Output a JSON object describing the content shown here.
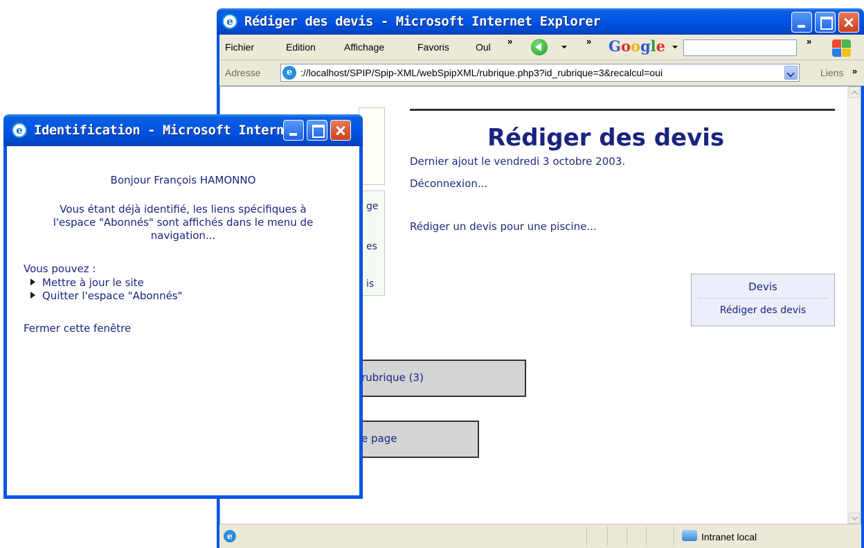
{
  "main_window": {
    "title": "Rédiger des devis - Microsoft Internet Explorer",
    "menu": [
      "Fichier",
      "Edition",
      "Affichage",
      "Favoris",
      "Oul"
    ],
    "google": "Google",
    "address_label": "Adresse",
    "address_url": "://localhost/SPIP/Spip-XML/webSpipXML/rubrique.php3?id_rubrique=3&recalcul=oui",
    "links_label": "Liens",
    "status_zone": "Intranet local"
  },
  "page": {
    "title": "Rédiger des devis",
    "date": "Dernier ajout le vendredi 3 octobre 2003.",
    "logout": "Déconnexion...",
    "link": "Rédiger un devis pour une piscine...",
    "side_fragments": [
      "ge",
      "es",
      "is"
    ],
    "nav_box": {
      "heading": "Devis",
      "link": "Rédiger des devis"
    },
    "button_rubrique": "rubrique (3)",
    "button_page": "e page"
  },
  "popup": {
    "title": "Identification - Microsoft Intern...",
    "greeting": "Bonjour François HAMONNO",
    "message": [
      "Vous étant déjà identifié, les liens spécifiques à",
      "l'espace \"Abonnés\" sont affichés dans le menu de",
      "navigation..."
    ],
    "options_label": "Vous pouvez :",
    "options": [
      "Mettre à jour le site",
      "Quitter l'espace \"Abonnés\""
    ],
    "close_link": "Fermer cette fenêtre"
  }
}
